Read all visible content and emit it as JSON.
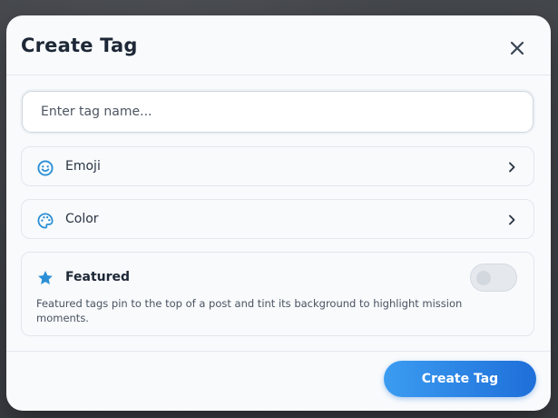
{
  "modal": {
    "title": "Create Tag"
  },
  "name_input": {
    "placeholder": "Enter tag name...",
    "value": ""
  },
  "options": {
    "emoji": {
      "label": "Emoji",
      "icon": "smiley-face-icon"
    },
    "color": {
      "label": "Color",
      "icon": "palette-icon"
    }
  },
  "featured": {
    "label": "Featured",
    "icon": "star-icon",
    "description": "Featured tags pin to the top of a post and tint its background to highlight mission moments.",
    "enabled": false
  },
  "footer": {
    "create_label": "Create Tag"
  },
  "colors": {
    "accent": "#1e6fd9",
    "accent_light": "#3b9cf1",
    "icon_blue": "#2b8fd6",
    "title_text": "#1d2736"
  }
}
